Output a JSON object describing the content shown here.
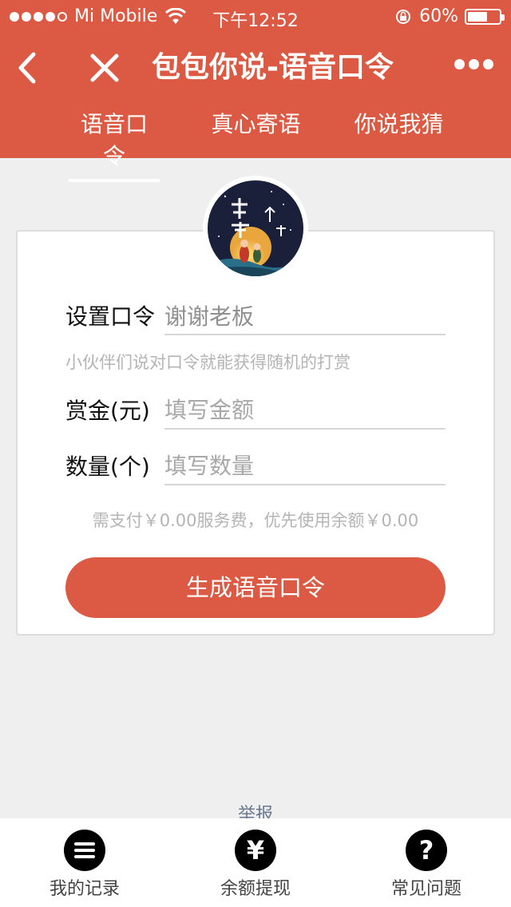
{
  "status_bar": {
    "carrier": "Mi Mobile",
    "time": "下午12:52",
    "battery": "60%"
  },
  "nav": {
    "title": "包包你说-语音口令"
  },
  "tabs": [
    {
      "label": "语音口令",
      "active": true
    },
    {
      "label": "真心寄语",
      "active": false
    },
    {
      "label": "你说我猜",
      "active": false
    }
  ],
  "form": {
    "command_label": "设置口令",
    "command_value": "谢谢老板",
    "hint": "小伙伴们说对口令就能获得随机的打赏",
    "reward_label": "赏金(元)",
    "reward_placeholder": "填写金额",
    "quantity_label": "数量(个)",
    "quantity_placeholder": "填写数量",
    "fee_text": "需支付￥0.00服务费，优先使用余额￥0.00",
    "submit_label": "生成语音口令"
  },
  "report_label": "举报",
  "bottom_bar": [
    {
      "label": "我的记录",
      "icon": "list-icon"
    },
    {
      "label": "余额提现",
      "icon": "yen-icon"
    },
    {
      "label": "常见问题",
      "icon": "question-icon"
    }
  ],
  "colors": {
    "brand": "#dc5a43",
    "background": "#efeff0"
  }
}
